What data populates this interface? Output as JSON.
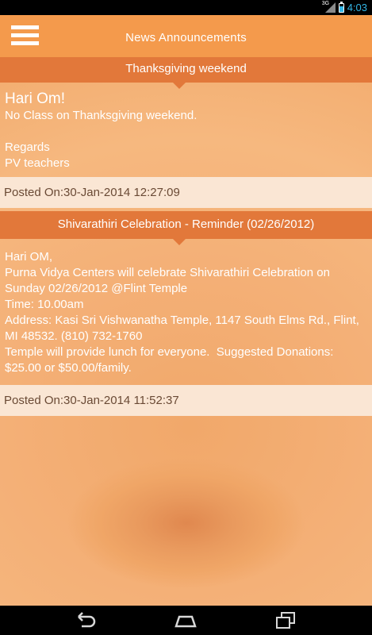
{
  "status_bar": {
    "network": "3G",
    "time": "4:03",
    "battery_level": 0.7
  },
  "header": {
    "title": "News Announcements"
  },
  "posts": [
    {
      "title": "Thanksgiving weekend",
      "greeting": "Hari Om!",
      "lines": [
        "No Class on Thanksgiving weekend.",
        "",
        "Regards",
        "PV teachers"
      ],
      "posted": "Posted On:30-Jan-2014 12:27:09"
    },
    {
      "title": "Shivarathiri Celebration - Reminder (02/26/2012)",
      "greeting": "Hari OM,",
      "lines": [
        "Purna Vidya Centers will celebrate Shivarathiri Celebration on Sunday 02/26/2012 @Flint Temple",
        "Time: 10.00am",
        "Address: Kasi Sri Vishwanatha Temple, 1147 South Elms Rd., Flint, MI 48532. (810) 732-1760",
        "Temple will provide lunch for everyone.  Suggested Donations: $25.00 or $50.00/family."
      ],
      "posted": "Posted On:30-Jan-2014 11:52:37"
    }
  ],
  "nav_bar": {
    "back_icon": "back-icon",
    "home_icon": "home-icon",
    "recents_icon": "recents-icon"
  }
}
